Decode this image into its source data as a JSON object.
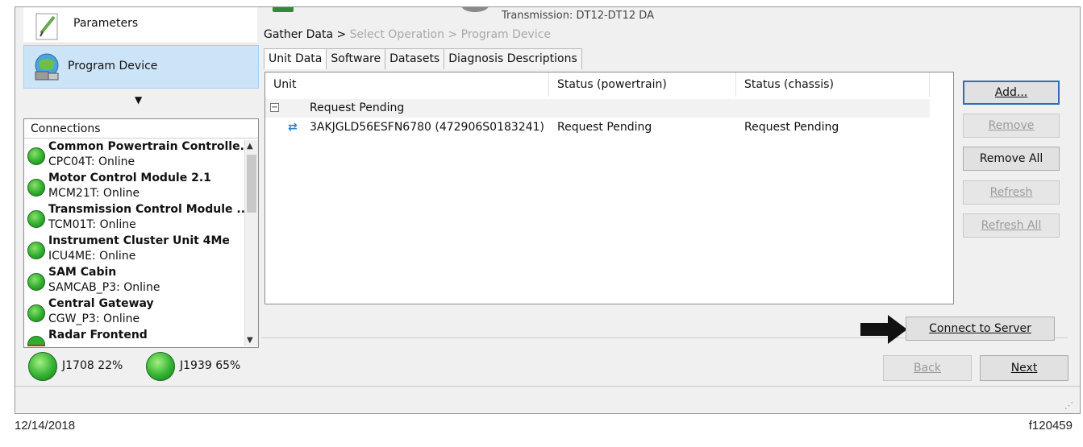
{
  "nav": {
    "parameters_label": "Parameters",
    "program_device_label": "Program Device"
  },
  "header": {
    "transmission": "Transmission: DT12-DT12 DA"
  },
  "breadcrumb": {
    "gather": "Gather Data >",
    "select": "Select Operation >",
    "program": "Program Device"
  },
  "tabs": [
    "Unit Data",
    "Software",
    "Datasets",
    "Diagnosis Descriptions"
  ],
  "table": {
    "columns": [
      "Unit",
      "Status (powertrain)",
      "Status (chassis)"
    ],
    "group_label": "Request Pending",
    "row": {
      "unit": "3AKJGLD56ESFN6780 (472906S0183241)",
      "powertrain": "Request Pending",
      "chassis": "Request Pending"
    }
  },
  "buttons": {
    "add": "Add...",
    "remove": "Remove",
    "remove_all": "Remove All",
    "refresh": "Refresh",
    "refresh_all": "Refresh All",
    "connect": "Connect to Server",
    "back": "Back",
    "next": "Next"
  },
  "connections": {
    "header": "Connections",
    "items": [
      {
        "name": "Common Powertrain Controlle...",
        "status": "CPC04T: Online"
      },
      {
        "name": "Motor Control Module 2.1",
        "status": "MCM21T: Online"
      },
      {
        "name": "Transmission Control Module ...",
        "status": "TCM01T: Online"
      },
      {
        "name": "Instrument Cluster Unit 4Me",
        "status": "ICU4ME: Online"
      },
      {
        "name": "SAM Cabin",
        "status": "SAMCAB_P3: Online"
      },
      {
        "name": "Central Gateway",
        "status": "CGW_P3: Online"
      },
      {
        "name": "Radar Frontend",
        "status": ""
      }
    ]
  },
  "bus": {
    "j1708": "J1708 22%",
    "j1939": "J1939 65%"
  },
  "footer": {
    "date": "12/14/2018",
    "figure_id": "f120459"
  }
}
